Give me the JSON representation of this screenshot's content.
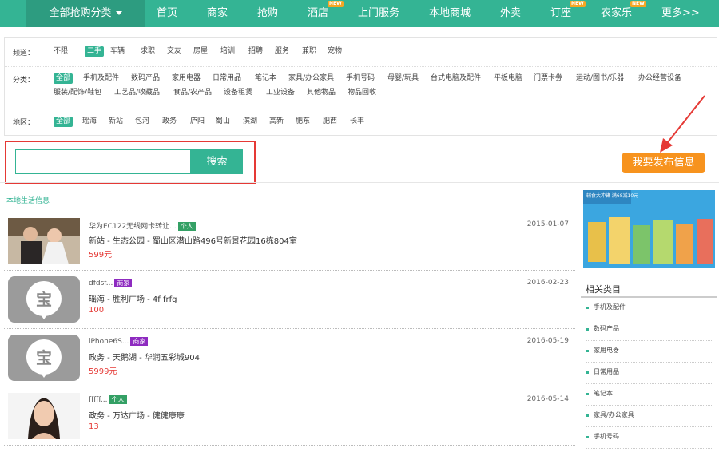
{
  "nav": {
    "category_label": "全部抢购分类",
    "items": [
      "首页",
      "商家",
      "抢购",
      "酒店",
      "上门服务",
      "本地商城",
      "外卖",
      "订座",
      "农家乐",
      "更多>>"
    ],
    "new_badge": "NEW"
  },
  "filters": {
    "channel": {
      "label": "频道：",
      "options": [
        "不限",
        "二手",
        "车辆",
        "求职",
        "交友",
        "房屋",
        "培训",
        "招聘",
        "服务",
        "兼职",
        "宠物"
      ],
      "selected": "二手"
    },
    "category": {
      "label": "分类：",
      "options": [
        "全部",
        "手机及配件",
        "数码产品",
        "家用电器",
        "日常用品",
        "笔记本",
        "家具/办公家具",
        "手机号码",
        "母婴/玩具",
        "台式电脑及配件",
        "平板电脑",
        "门票卡劵",
        "运动/图书/乐器",
        "办公经营设备",
        "服装/配饰/鞋包",
        "工艺品/收藏品",
        "食品/农产品",
        "设备租赁",
        "工业设备",
        "其他物品",
        "物品回收"
      ],
      "selected": "全部"
    },
    "region": {
      "label": "地区：",
      "options": [
        "全部",
        "瑶海",
        "新站",
        "包河",
        "政务",
        "庐阳",
        "蜀山",
        "滨湖",
        "高新",
        "肥东",
        "肥西",
        "长丰"
      ],
      "selected": "全部"
    }
  },
  "search": {
    "placeholder": "",
    "button_label": "搜索"
  },
  "post_button_label": "我要发布信息",
  "section_title": "本地生活信息",
  "listings": [
    {
      "title": "华为EC122无线网卡转让...",
      "tag": "个人",
      "tag_type": "person",
      "address": "新站 - 生态公园 - 蜀山区潜山路496号新景花园16栋804室",
      "price": "599元",
      "date": "2015-01-07",
      "thumb": "couple-photo"
    },
    {
      "title": "dfdsf...",
      "tag": "商家",
      "tag_type": "biz",
      "address": "瑶海 - 胜利广场 - 4f frfg",
      "price": "100",
      "date": "2016-02-23",
      "thumb": "bao-logo",
      "thumb_char": "宝"
    },
    {
      "title": "iPhone6S...",
      "tag": "商家",
      "tag_type": "biz",
      "address": "政务 - 天鹅湖 - 华润五彩城904",
      "price": "5999元",
      "date": "2016-05-19",
      "thumb": "bao-logo",
      "thumb_char": "宝"
    },
    {
      "title": "fffff...",
      "tag": "个人",
      "tag_type": "person",
      "address": "政务 - 万达广场 - 健健康康",
      "price": "13",
      "date": "2016-05-14",
      "thumb": "woman-photo"
    }
  ],
  "sidebar": {
    "ad_text": "辅食大冲锋 满68减10元",
    "related_title": "相关类目",
    "related_items": [
      "手机及配件",
      "数码产品",
      "家用电器",
      "日常用品",
      "笔记本",
      "家具/办公家具",
      "手机号码"
    ]
  },
  "colors": {
    "brand_green": "#34b494",
    "accent_orange": "#f7931e",
    "highlight_red": "#e53935",
    "price_red": "#e53935"
  }
}
